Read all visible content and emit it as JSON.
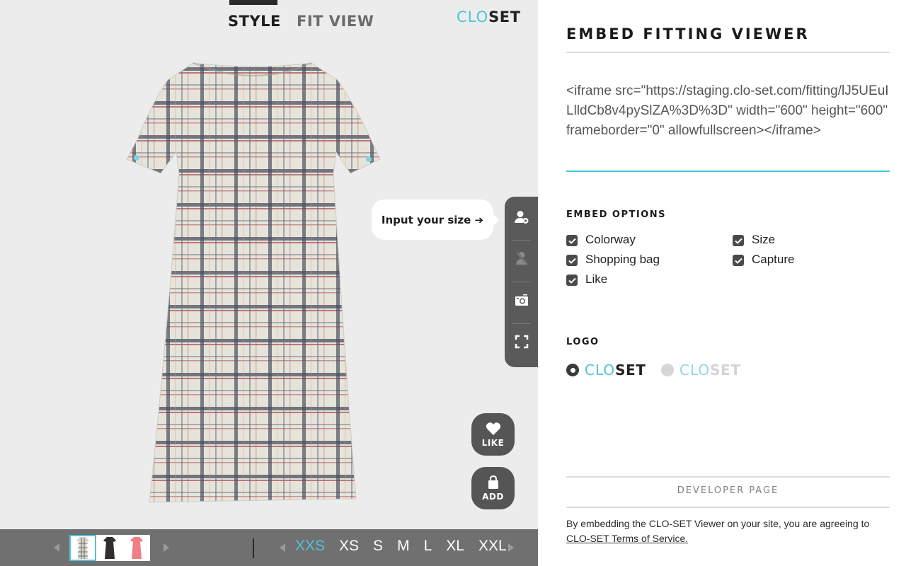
{
  "viewer": {
    "tabs": [
      {
        "label": "STYLE",
        "active": true
      },
      {
        "label": "FIT VIEW",
        "active": false
      }
    ],
    "brand": {
      "clo": "CLO",
      "set": "SET"
    },
    "size_prompt": "Input your size ➔",
    "tools": [
      {
        "name": "avatar-settings",
        "icon": "avatar-settings-icon"
      },
      {
        "name": "hide-avatar",
        "icon": "avatar-hidden-icon"
      },
      {
        "name": "capture",
        "icon": "camera-icon"
      },
      {
        "name": "fullscreen",
        "icon": "fullscreen-icon"
      }
    ],
    "like_label": "LIKE",
    "add_label": "ADD",
    "colorways": [
      {
        "name": "plaid",
        "selected": true
      },
      {
        "name": "black",
        "selected": false
      },
      {
        "name": "pink",
        "selected": false
      }
    ],
    "sizes": [
      "XXS",
      "XS",
      "S",
      "M",
      "L",
      "XL",
      "XXL"
    ],
    "selected_size": "XXS"
  },
  "panel": {
    "title": "EMBED FITTING VIEWER",
    "embed_code": "<iframe src=\"https://staging.clo-set.com/fitting/lJ5UEuILlldCb8v4pySlZA%3D%3D\" width=\"600\" height=\"600\" frameborder=\"0\" allowfullscreen></iframe>",
    "embed_options_label": "EMBED OPTIONS",
    "options": [
      {
        "label": "Colorway",
        "checked": true
      },
      {
        "label": "Shopping bag",
        "checked": true
      },
      {
        "label": "Like",
        "checked": true
      },
      {
        "label": "Size",
        "checked": true
      },
      {
        "label": "Capture",
        "checked": true
      }
    ],
    "logo_label": "LOGO",
    "logo_options": [
      {
        "clo": "CLO",
        "set": "SET",
        "selected": true
      },
      {
        "clo": "CLO",
        "set": "SET",
        "selected": false
      }
    ],
    "developer_page": "DEVELOPER PAGE",
    "terms_text": "By embedding the CLO-SET Viewer on your site, you are agreeing to",
    "terms_link": "CLO-SET Terms of Service."
  },
  "colors": {
    "accent": "#4fc3d6",
    "viewer_bg": "#ececec",
    "toolbar": "#5a5a5a",
    "bottom_bar": "#707070"
  }
}
